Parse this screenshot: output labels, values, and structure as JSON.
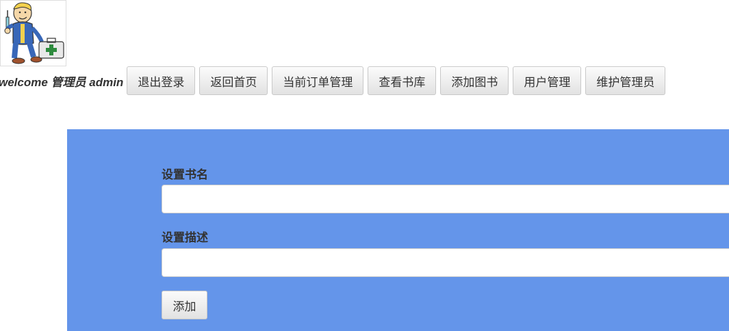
{
  "header": {
    "avatar_icon": "vault-boy-medic-icon",
    "welcome_text": "welcome 管理员 admin"
  },
  "nav": {
    "buttons": [
      {
        "label": "退出登录"
      },
      {
        "label": "返回首页"
      },
      {
        "label": "当前订单管理"
      },
      {
        "label": "查看书库"
      },
      {
        "label": "添加图书"
      },
      {
        "label": "用户管理"
      },
      {
        "label": "维护管理员"
      }
    ]
  },
  "form": {
    "background_color": "#6495ea",
    "title_label": "设置书名",
    "title_value": "",
    "description_label": "设置描述",
    "description_value": "",
    "submit_label": "添加"
  }
}
